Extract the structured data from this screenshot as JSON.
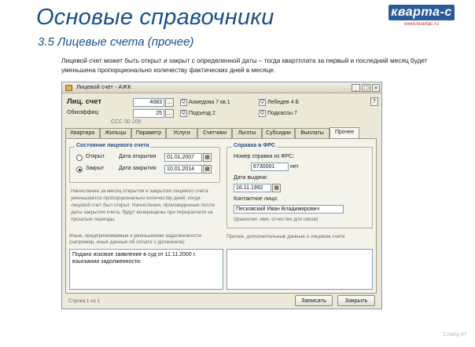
{
  "slide": {
    "title": "Основые справочники",
    "subtitle": "3.5  Лицевые счета (прочее)",
    "description": "Лицевой счет может быть открыт и закрыт с определенной даты – тогда квартплата за первый и последний месяц будет уменьшена пропорционально количеству фактических дней в месяце.",
    "logo_text": "кварта-с",
    "logo_sub": "www.kvartac.ru",
    "page_number": "Слайд 47"
  },
  "window": {
    "title": "Лицевой счет - АЖК",
    "header": {
      "account_label": "Лиц. счет",
      "account_value": "4083",
      "ratio_label": "Обкоэффиц:",
      "ratio_value": "25",
      "date_value": "ССС 00 200",
      "street_value": "Ахмедова 7 кв.1",
      "house_value": "Подъезд 2",
      "group_a_value": "Лебедев 4 Б",
      "group_b_value": "Подкассы 7"
    },
    "tabs": [
      "Квартира",
      "Жильцы",
      "Параметр",
      "Услуги",
      "Счетчики",
      "Льготы",
      "Субсидии",
      "Выплаты",
      "Прочее"
    ],
    "active_tab": "Прочее",
    "status_group": {
      "title": "Состояние лицевого счета",
      "open_label": "Открыт",
      "closed_label": "Закрыт",
      "open_date_label": "Дата открытия",
      "open_date": "01.01.2007",
      "close_date_label": "Дата закрытия",
      "close_date": "10.01.2014",
      "selected": "Закрыт"
    },
    "note": "Начисление за месяц открытия и закрытия лицевого счета уменьшается пропорционально количеству дней, когда лицевой счет был открыт. Начисления, произведенные после даты закрытия счета, будут возвращены при перерасчете за прошлые периоды.",
    "pfr_group": {
      "title": "Справка в ФРС",
      "number_label": "Номер справки из ФРС:",
      "number_value": "6730001",
      "number_suffix": "нет",
      "date_label": "Дата выдачи:",
      "date_value": "16.11.1992",
      "contact_label": "Контактное лицо:",
      "contact_value": "Песковский Иван Владимирович",
      "contact_note": "(фамилия, имя, отчество для связи)"
    },
    "reasons_label": "Иные, предпринимаемые к уменьшению задолженности (например, иные данные об оплате с должников)",
    "reasons_text": "Подано исковое заявление в суд от 11.11.2000 г. взыскании задолженности.",
    "remarks_label": "Прочее, дополнительные данные о лицевом счете",
    "remarks_text": "",
    "footer_status": "Строка 1 из 1",
    "save_button": "Записать",
    "close_button": "Закрыть"
  }
}
